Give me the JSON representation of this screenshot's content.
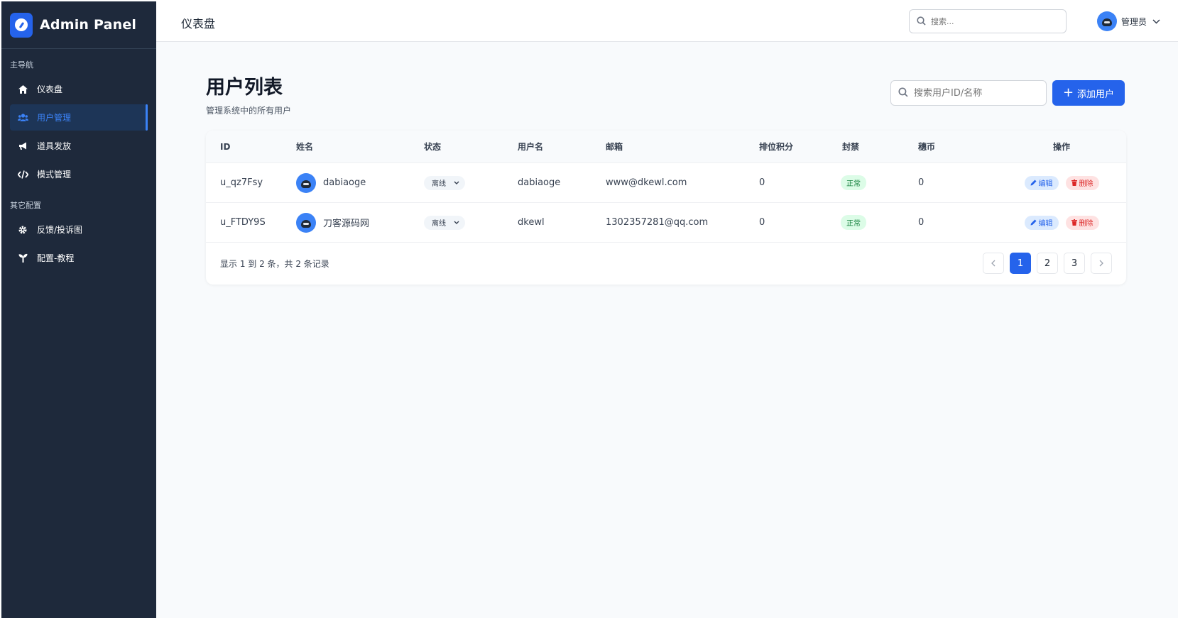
{
  "brand": {
    "title": "Admin Panel"
  },
  "sidebar": {
    "sections": [
      {
        "title": "主导航",
        "items": [
          {
            "label": "仪表盘",
            "icon": "home-icon",
            "active": false
          },
          {
            "label": "用户管理",
            "icon": "users-icon",
            "active": true
          },
          {
            "label": "道具发放",
            "icon": "megaphone-icon",
            "active": false
          },
          {
            "label": "模式管理",
            "icon": "code-icon",
            "active": false
          }
        ]
      },
      {
        "title": "其它配置",
        "items": [
          {
            "label": "反馈/投诉图",
            "icon": "gear-icon",
            "active": false
          },
          {
            "label": "配置-教程",
            "icon": "seedling-icon",
            "active": false
          }
        ]
      }
    ]
  },
  "topbar": {
    "title": "仪表盘",
    "search_placeholder": "搜索...",
    "user_name": "管理员"
  },
  "page": {
    "title": "用户列表",
    "subtitle": "管理系统中的所有用户",
    "search_placeholder": "搜索用户ID/名称",
    "add_label": "添加用户"
  },
  "table": {
    "columns": [
      "ID",
      "姓名",
      "状态",
      "用户名",
      "邮箱",
      "排位积分",
      "封禁",
      "穗币",
      "操作"
    ],
    "rows": [
      {
        "id": "u_qz7Fsy",
        "name": "dabiaoge",
        "status": "离线",
        "username": "dabiaoge",
        "email": "www@dkewl.com",
        "rank": "0",
        "ban": "正常",
        "coin": "0"
      },
      {
        "id": "u_FTDY9S",
        "name": "刀客源码网",
        "status": "离线",
        "username": "dkewl",
        "email": "1302357281@qq.com",
        "rank": "0",
        "ban": "正常",
        "coin": "0"
      }
    ],
    "edit_label": "编辑",
    "delete_label": "删除",
    "summary": "显示 1 到 2 条，共 2 条记录"
  },
  "pagination": {
    "pages": [
      "1",
      "2",
      "3"
    ],
    "current": "1"
  },
  "colors": {
    "sidebar_bg": "#1e293b",
    "primary": "#2563eb",
    "success": "#15803d",
    "danger": "#dc2626"
  }
}
